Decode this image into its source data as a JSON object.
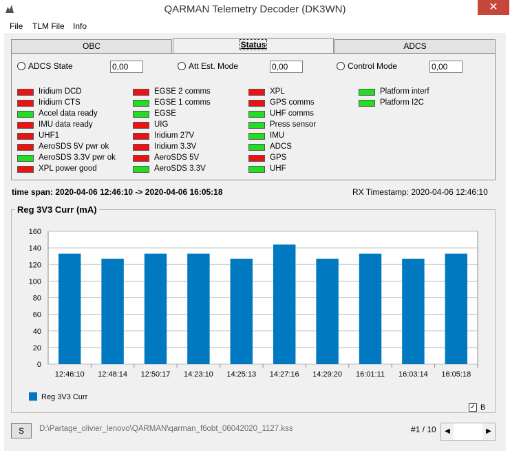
{
  "window": {
    "title": "QARMAN Telemetry Decoder (DK3WN)",
    "close_glyph": "✕"
  },
  "menu": [
    "File",
    "TLM File",
    "Info"
  ],
  "tabs": [
    {
      "label": "OBC",
      "active": false
    },
    {
      "label": "Status",
      "active": true
    },
    {
      "label": "ADCS",
      "active": false
    }
  ],
  "status_fields": [
    {
      "label": "ADCS State",
      "value": "0,00"
    },
    {
      "label": "Att Est. Mode",
      "value": "0,00"
    },
    {
      "label": "Control Mode",
      "value": "0,00"
    }
  ],
  "colors": {
    "led_red": "#ee1111",
    "led_green": "#22dd22",
    "bar": "#0079c1",
    "close": "#c7463b"
  },
  "indicators": [
    [
      {
        "label": "Iridium DCD",
        "state": "red"
      },
      {
        "label": "Iridium CTS",
        "state": "red"
      },
      {
        "label": "Accel data ready",
        "state": "green"
      },
      {
        "label": "IMU data ready",
        "state": "red"
      },
      {
        "label": "UHF1",
        "state": "red"
      },
      {
        "label": "AeroSDS 5V pwr ok",
        "state": "red"
      },
      {
        "label": "AeroSDS 3.3V pwr ok",
        "state": "green"
      },
      {
        "label": "XPL power good",
        "state": "red"
      }
    ],
    [
      {
        "label": "EGSE 2 comms",
        "state": "red"
      },
      {
        "label": "EGSE 1 comms",
        "state": "green"
      },
      {
        "label": "EGSE",
        "state": "green"
      },
      {
        "label": "UIG",
        "state": "red"
      },
      {
        "label": "Iridium 27V",
        "state": "red"
      },
      {
        "label": "Iridium 3.3V",
        "state": "red"
      },
      {
        "label": "AeroSDS 5V",
        "state": "red"
      },
      {
        "label": "AeroSDS 3.3V",
        "state": "green"
      }
    ],
    [
      {
        "label": "XPL",
        "state": "red"
      },
      {
        "label": "GPS comms",
        "state": "red"
      },
      {
        "label": "UHF comms",
        "state": "green"
      },
      {
        "label": "Press sensor",
        "state": "green"
      },
      {
        "label": "IMU",
        "state": "green"
      },
      {
        "label": "ADCS",
        "state": "green"
      },
      {
        "label": "GPS",
        "state": "red"
      },
      {
        "label": "UHF",
        "state": "green"
      }
    ],
    [
      {
        "label": "Platform interf",
        "state": "green"
      },
      {
        "label": "Platform I2C",
        "state": "green"
      }
    ]
  ],
  "time_span": "time span: 2020-04-06 12:46:10 -> 2020-04-06 16:05:18",
  "rx_timestamp": "RX Timestamp: 2020-04-06 12:46:10",
  "chart_title": "Reg 3V3 Curr (mA)",
  "chart_data": {
    "type": "bar",
    "categories": [
      "12:46:10",
      "12:48:14",
      "12:50:17",
      "14:23:10",
      "14:25:13",
      "14:27:16",
      "14:29:20",
      "16:01:11",
      "16:03:14",
      "16:05:18"
    ],
    "series": [
      {
        "name": "Reg 3V3 Curr",
        "values": [
          133,
          127,
          133,
          133,
          127,
          144,
          127,
          133,
          127,
          133
        ]
      }
    ],
    "ylim": [
      0,
      160
    ],
    "yticks": [
      0,
      20,
      40,
      60,
      80,
      100,
      120,
      140,
      160
    ],
    "grid": true,
    "legend": "bottom-left"
  },
  "checkbox": {
    "label": "B",
    "checked": true,
    "mark": "✓"
  },
  "bottom": {
    "button_label": "S",
    "file_path": "D:\\Partage_olivier_lenovo\\QARMAN\\qarman_f6obt_06042020_1127.kss",
    "page": "#1 / 10",
    "left_arrow": "◀",
    "right_arrow": "▶"
  }
}
